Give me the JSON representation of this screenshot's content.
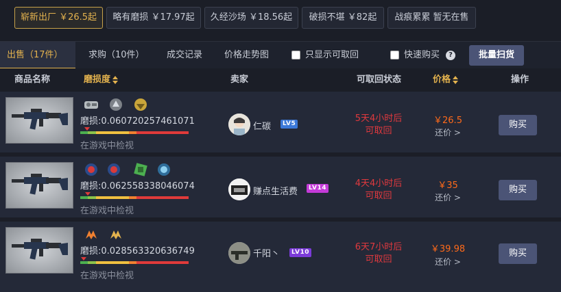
{
  "wear_filters": [
    {
      "label": "崭新出厂 ￥26.5起",
      "active": true
    },
    {
      "label": "略有磨损 ￥17.97起",
      "active": false
    },
    {
      "label": "久经沙场 ￥18.56起",
      "active": false
    },
    {
      "label": "破损不堪 ￥82起",
      "active": false
    },
    {
      "label": "战痕累累 暂无在售",
      "active": false
    }
  ],
  "tabs": {
    "sell": "出售（17件）",
    "buy": "求购（10件）",
    "history": "成交记录",
    "trend": "价格走势图"
  },
  "filters": {
    "only_retrievable": "只显示可取回",
    "quick_buy": "快速购买",
    "help_icon": "?"
  },
  "bulk_buy_label": "批量扫货",
  "columns": {
    "name": "商品名称",
    "wear": "磨损度",
    "seller": "卖家",
    "status": "可取回状态",
    "price": "价格",
    "action": "操作"
  },
  "colors": {
    "accent": "#e3b24e",
    "status_red": "#e0393e",
    "price_orange": "#ff6a1a",
    "button": "#4b5476"
  },
  "listings": [
    {
      "stickers": [
        "sticker-gray-badge",
        "sticker-wings",
        "sticker-gold-emblem"
      ],
      "wear": "磨损:0.060720257461071",
      "wear_fraction": 0.06,
      "inspect": "在游戏中检视",
      "seller": "仁碳",
      "level": "LV5",
      "level_color": "#3b78d8",
      "status_line1": "5天4小时后",
      "status_line2": "可取回",
      "price": "￥26.5",
      "counter": "还价 >",
      "buy": "购买"
    },
    {
      "stickers": [
        "sticker-red-circle",
        "sticker-red-circle",
        "sticker-green-hand",
        "sticker-blue-circle"
      ],
      "wear": "磨损:0.062558338046074",
      "wear_fraction": 0.062,
      "inspect": "在游戏中检视",
      "seller": "赚点生活费",
      "level": "LV14",
      "level_color": "#c43bd8",
      "status_line1": "4天4小时后",
      "status_line2": "可取回",
      "price": "￥35",
      "counter": "还价 >",
      "buy": "购买"
    },
    {
      "stickers": [
        "sticker-fnatic",
        "sticker-fnatic-gold"
      ],
      "wear": "磨损:0.028563320636749",
      "wear_fraction": 0.028,
      "inspect": "在游戏中检视",
      "seller": "千阳丶",
      "level": "LV10",
      "level_color": "#7b3bd8",
      "status_line1": "6天7小时后",
      "status_line2": "可取回",
      "price": "￥39.98",
      "counter": "还价 >",
      "buy": "购买"
    }
  ]
}
